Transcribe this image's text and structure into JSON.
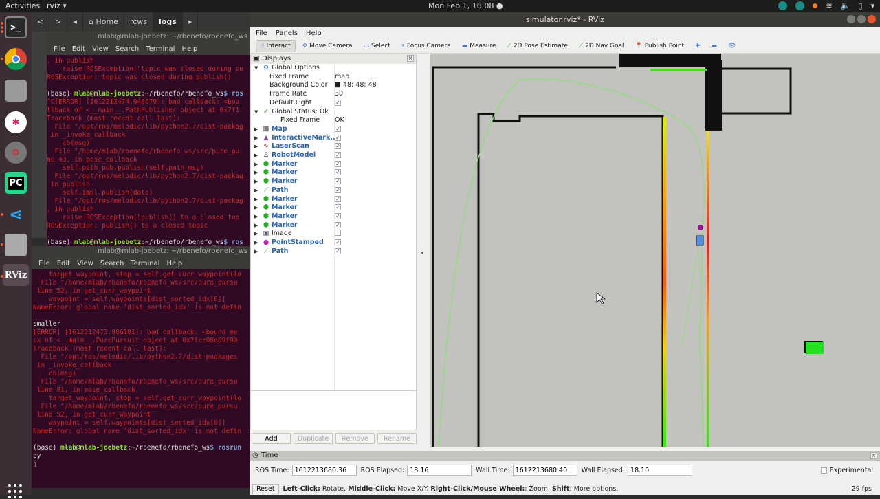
{
  "topbar": {
    "activities": "Activities",
    "app": "rviz ▾",
    "clock": "Mon Feb 1, 16:08 ●"
  },
  "dock": {
    "items": [
      "Terminal",
      "Chrome",
      "Files",
      "Slack",
      "Settings",
      "PyCharm",
      "VS Code",
      "Disks",
      "RViz"
    ],
    "labels": {
      "terminal": ">_",
      "pycharm": "PC",
      "rviz": "RViz"
    }
  },
  "nautilus": {
    "back": "<",
    "forward": ">",
    "left": "◂",
    "home": "⌂ Home",
    "crumbs": [
      "rcws",
      "logs"
    ],
    "more": "▸"
  },
  "term1": {
    "title": "mlab@mlab-joebetz: ~/rbenefo/rbenefo_ws",
    "menu": [
      "File",
      "Edit",
      "View",
      "Search",
      "Terminal",
      "Help"
    ],
    "lines": [
      {
        "c": "e",
        "t": ", in publish"
      },
      {
        "c": "e",
        "t": "    raise ROSException(\"topic was closed during pu"
      },
      {
        "c": "e",
        "t": "ROSException: topic was closed during publish()"
      },
      {
        "c": "e",
        "t": ""
      },
      {
        "c": "p",
        "t": "(base) |mlab@mlab-joebetz|:~/rbenefo/rbenefo_ws|$ ros"
      },
      {
        "c": "e",
        "t": "^C[ERROR] [1612212474.948679]: bad callback: <bou"
      },
      {
        "c": "e",
        "t": "llback of <__main__.PathPublisher object at 0x7f1"
      },
      {
        "c": "e",
        "t": "Traceback (most recent call last):"
      },
      {
        "c": "e",
        "t": "  File \"/opt/ros/melodic/lib/python2.7/dist-packag"
      },
      {
        "c": "e",
        "t": " in _invoke_callback"
      },
      {
        "c": "e",
        "t": "    cb(msg)"
      },
      {
        "c": "e",
        "t": "  File \"/home/mlab/rbenefo/rbenefo_ws/src/pure_pu"
      },
      {
        "c": "e",
        "t": "ne 43, in pose_callback"
      },
      {
        "c": "e",
        "t": "    self.path_pub.publish(self.path_msg)"
      },
      {
        "c": "e",
        "t": "  File \"/opt/ros/melodic/lib/python2.7/dist-packag"
      },
      {
        "c": "e",
        "t": " in publish"
      },
      {
        "c": "e",
        "t": "    self.impl.publish(data)"
      },
      {
        "c": "e",
        "t": "  File \"/opt/ros/melodic/lib/python2.7/dist-packag"
      },
      {
        "c": "e",
        "t": ", in publish"
      },
      {
        "c": "e",
        "t": "    raise ROSException(\"publish() to a closed top"
      },
      {
        "c": "e",
        "t": "ROSException: publish() to a closed topic"
      },
      {
        "c": "e",
        "t": ""
      },
      {
        "c": "p",
        "t": "(base) |mlab@mlab-joebetz|:~/rbenefo/rbenefo_ws|$ ros"
      }
    ]
  },
  "term2": {
    "title": "mlab@mlab-joebetz: ~/rbenefo/rbenefo_ws",
    "menu": [
      "File",
      "Edit",
      "View",
      "Search",
      "Terminal",
      "Help"
    ],
    "lines": [
      {
        "c": "e",
        "t": "    target_waypoint, stop = self.get_curr_waypoint(lo"
      },
      {
        "c": "e",
        "t": "  File \"/home/mlab/rbenefo/rbenefo_ws/src/pure_pursu"
      },
      {
        "c": "e",
        "t": " line 52, in get_curr_waypoint"
      },
      {
        "c": "e",
        "t": "    waypoint = self.waypoints[dist_sorted_idx[0]]"
      },
      {
        "c": "e",
        "t": "NameError: global name 'dist_sorted_idx' is not defin"
      },
      {
        "c": "e",
        "t": ""
      },
      {
        "c": "w",
        "t": "smaller"
      },
      {
        "c": "e",
        "t": "[ERROR] [1612212473.986181]: bad callback: <bound me"
      },
      {
        "c": "e",
        "t": "ck of <__main__.PurePursuit object at 0x7fec08e89f90"
      },
      {
        "c": "e",
        "t": "Traceback (most recent call last):"
      },
      {
        "c": "e",
        "t": "  File \"/opt/ros/melodic/lib/python2.7/dist-packages"
      },
      {
        "c": "e",
        "t": " in _invoke_callback"
      },
      {
        "c": "e",
        "t": "    cb(msg)"
      },
      {
        "c": "e",
        "t": "  File \"/home/mlab/rbenefo/rbenefo_ws/src/pure_pursu"
      },
      {
        "c": "e",
        "t": " line 81, in pose_callback"
      },
      {
        "c": "e",
        "t": "    target_waypoint, stop = self.get_curr_waypoint(lo"
      },
      {
        "c": "e",
        "t": "  File \"/home/mlab/rbenefo/rbenefo_ws/src/pure_pursu"
      },
      {
        "c": "e",
        "t": " line 52, in get_curr_waypoint"
      },
      {
        "c": "e",
        "t": "    waypoint = self.waypoints[dist_sorted_idx[0]]"
      },
      {
        "c": "e",
        "t": "NameError: global name 'dist_sorted_idx' is not defin"
      },
      {
        "c": "e",
        "t": ""
      },
      {
        "c": "p",
        "t": "(base) |mlab@mlab-joebetz|:~/rbenefo/rbenefo_ws|$ rosrun"
      },
      {
        "c": "w",
        "t": "py"
      },
      {
        "c": "w",
        "t": "▯"
      }
    ]
  },
  "rviz": {
    "title": "simulator.rviz* - RViz",
    "menu": [
      "File",
      "Panels",
      "Help"
    ],
    "toolbar": [
      {
        "icon": "☝",
        "label": "Interact",
        "active": true
      },
      {
        "icon": "✥",
        "label": "Move Camera"
      },
      {
        "icon": "▭",
        "label": "Select"
      },
      {
        "icon": "⌖",
        "label": "Focus Camera"
      },
      {
        "icon": "▬",
        "label": "Measure"
      },
      {
        "icon": "⟋",
        "label": "2D Pose Estimate"
      },
      {
        "icon": "⟋",
        "label": "2D Nav Goal"
      },
      {
        "icon": "📍",
        "label": "Publish Point"
      },
      {
        "icon": "✚",
        "label": ""
      },
      {
        "icon": "▬",
        "label": ""
      },
      {
        "icon": "👁",
        "label": ""
      }
    ],
    "displays": {
      "title": "Displays",
      "rows": [
        {
          "d": 0,
          "arrow": "▼",
          "icon": "⚙",
          "ic": "#4a78c8",
          "name": "Global Options",
          "blue": false,
          "val": ""
        },
        {
          "d": 1,
          "arrow": "",
          "icon": "",
          "name": "Fixed Frame",
          "val": "map"
        },
        {
          "d": 1,
          "arrow": "",
          "icon": "",
          "name": "Background Color",
          "val": "■ 48; 48; 48"
        },
        {
          "d": 1,
          "arrow": "",
          "icon": "",
          "name": "Frame Rate",
          "val": "30"
        },
        {
          "d": 1,
          "arrow": "",
          "icon": "",
          "name": "Default Light",
          "chk": true
        },
        {
          "d": 0,
          "arrow": "▼",
          "icon": "✓",
          "ic": "#2a9a2a",
          "name": "Global Status: Ok",
          "val": ""
        },
        {
          "d": 1,
          "arrow": "",
          "icon": "✓",
          "ic": "#2a9a2a",
          "name": "Fixed Frame",
          "val": "OK"
        },
        {
          "d": 0,
          "arrow": "▶",
          "icon": "▦",
          "ic": "#555",
          "name": "Map",
          "blue": true,
          "chk": true
        },
        {
          "d": 0,
          "arrow": "▶",
          "icon": "▲",
          "ic": "#7a4aa0",
          "name": "InteractiveMark...",
          "blue": true,
          "chk": true
        },
        {
          "d": 0,
          "arrow": "▶",
          "icon": "∿",
          "ic": "#c02020",
          "name": "LaserScan",
          "blue": true,
          "chk": true
        },
        {
          "d": 0,
          "arrow": "▶",
          "icon": "♙",
          "ic": "#444",
          "name": "RobotModel",
          "blue": true,
          "chk": true
        },
        {
          "d": 0,
          "arrow": "▶",
          "icon": "⬢",
          "ic": "#1fae1f",
          "name": "Marker",
          "blue": true,
          "chk": true
        },
        {
          "d": 0,
          "arrow": "▶",
          "icon": "⬢",
          "ic": "#1fae1f",
          "name": "Marker",
          "blue": true,
          "chk": true
        },
        {
          "d": 0,
          "arrow": "▶",
          "icon": "⬢",
          "ic": "#1fae1f",
          "name": "Marker",
          "blue": true,
          "chk": true
        },
        {
          "d": 0,
          "arrow": "▶",
          "icon": "⟋",
          "ic": "#3ac23a",
          "name": "Path",
          "blue": true,
          "chk": true
        },
        {
          "d": 0,
          "arrow": "▶",
          "icon": "⬢",
          "ic": "#1fae1f",
          "name": "Marker",
          "blue": true,
          "chk": true
        },
        {
          "d": 0,
          "arrow": "▶",
          "icon": "⬢",
          "ic": "#1fae1f",
          "name": "Marker",
          "blue": true,
          "chk": true
        },
        {
          "d": 0,
          "arrow": "▶",
          "icon": "⬢",
          "ic": "#1fae1f",
          "name": "Marker",
          "blue": true,
          "chk": true
        },
        {
          "d": 0,
          "arrow": "▶",
          "icon": "⬢",
          "ic": "#1fae1f",
          "name": "Marker",
          "blue": true,
          "chk": true
        },
        {
          "d": 0,
          "arrow": "▶",
          "icon": "▣",
          "ic": "#556",
          "name": "Image",
          "blue": false,
          "chk": false
        },
        {
          "d": 0,
          "arrow": "▶",
          "icon": "●",
          "ic": "#c020c0",
          "name": "PointStamped",
          "blue": true,
          "chk": true
        },
        {
          "d": 0,
          "arrow": "▶",
          "icon": "⟋",
          "ic": "#3ac23a",
          "name": "Path",
          "blue": true,
          "chk": true
        }
      ],
      "buttons": {
        "add": "Add",
        "duplicate": "Duplicate",
        "remove": "Remove",
        "rename": "Rename"
      }
    },
    "time": {
      "title": "Time",
      "ros_time_label": "ROS Time:",
      "ros_time": "1612213680.36",
      "ros_elapsed_label": "ROS Elapsed:",
      "ros_elapsed": "18.16",
      "wall_time_label": "Wall Time:",
      "wall_time": "1612213680.40",
      "wall_elapsed_label": "Wall Elapsed:",
      "wall_elapsed": "18.10",
      "experimental": "Experimental"
    },
    "status": {
      "reset": "Reset",
      "hint_parts": [
        [
          "Left-Click:",
          " Rotate. "
        ],
        [
          "Middle-Click:",
          " Move X/Y. "
        ],
        [
          "Right-Click/Mouse Wheel:",
          ": Zoom. "
        ],
        [
          "Shift",
          ": More options."
        ]
      ],
      "fps": "29 fps"
    }
  }
}
